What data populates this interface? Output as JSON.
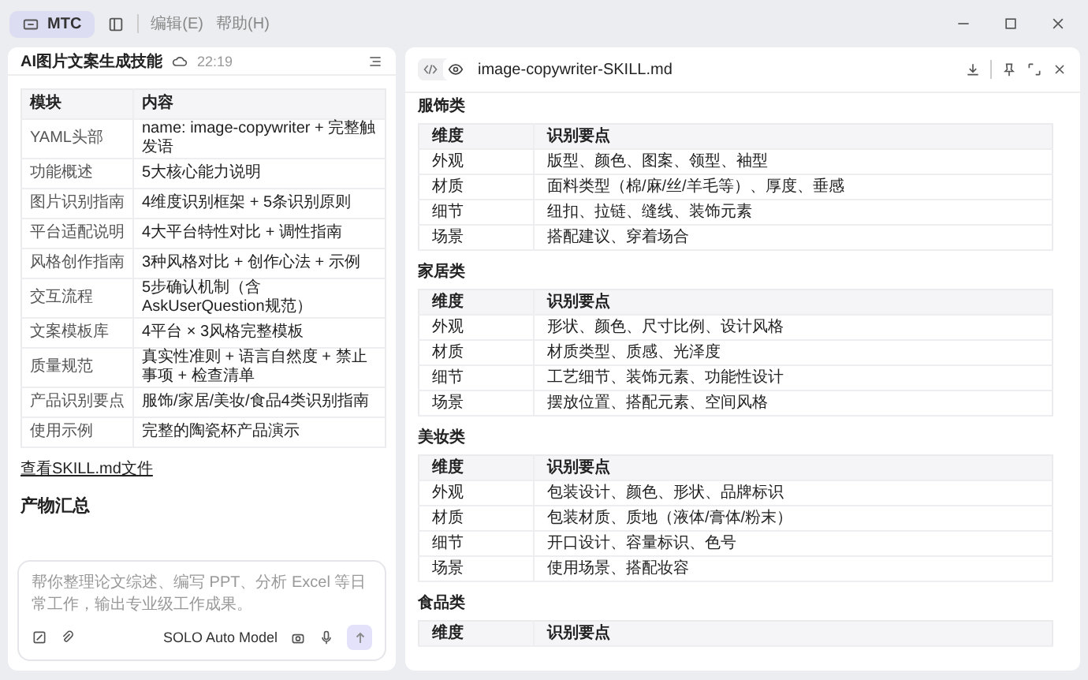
{
  "titlebar": {
    "tabs": [
      {
        "label": "MTC",
        "selected": true
      }
    ],
    "menus": [
      "编辑(E)",
      "帮助(H)"
    ]
  },
  "chat": {
    "title": "AI图片文案生成技能",
    "time": "22:19",
    "table": {
      "columns": [
        "模块",
        "内容"
      ],
      "rows": [
        [
          "YAML头部",
          "name: image-copywriter + 完整触发语"
        ],
        [
          "功能概述",
          "5大核心能力说明"
        ],
        [
          "图片识别指南",
          "4维度识别框架 + 5条识别原则"
        ],
        [
          "平台适配说明",
          "4大平台特性对比 + 调性指南"
        ],
        [
          "风格创作指南",
          "3种风格对比 + 创作心法 + 示例"
        ],
        [
          "交互流程",
          "5步确认机制（含AskUserQuestion规范）"
        ],
        [
          "文案模板库",
          "4平台 × 3风格完整模板"
        ],
        [
          "质量规范",
          "真实性准则 + 语言自然度 + 禁止事项 + 检查清单"
        ],
        [
          "产品识别要点",
          "服饰/家居/美妆/食品4类识别指南"
        ],
        [
          "使用示例",
          "完整的陶瓷杯产品演示"
        ]
      ]
    },
    "link": "查看SKILL.md文件",
    "heading": "产物汇总",
    "input": {
      "placeholder": "帮你整理论文综述、编写 PPT、分析 Excel 等日常工作，输出专业级工作成果。",
      "model": "SOLO Auto Model"
    }
  },
  "preview": {
    "filename": "image-copywriter-SKILL.md",
    "view_modes": [
      {
        "kind": "code",
        "selected": false
      },
      {
        "kind": "preview",
        "selected": true
      }
    ],
    "sections": [
      {
        "title": "服饰类",
        "columns": [
          "维度",
          "识别要点"
        ],
        "rows": [
          [
            "外观",
            "版型、颜色、图案、领型、袖型"
          ],
          [
            "材质",
            "面料类型（棉/麻/丝/羊毛等）、厚度、垂感"
          ],
          [
            "细节",
            "纽扣、拉链、缝线、装饰元素"
          ],
          [
            "场景",
            "搭配建议、穿着场合"
          ]
        ]
      },
      {
        "title": "家居类",
        "columns": [
          "维度",
          "识别要点"
        ],
        "rows": [
          [
            "外观",
            "形状、颜色、尺寸比例、设计风格"
          ],
          [
            "材质",
            "材质类型、质感、光泽度"
          ],
          [
            "细节",
            "工艺细节、装饰元素、功能性设计"
          ],
          [
            "场景",
            "摆放位置、搭配元素、空间风格"
          ]
        ]
      },
      {
        "title": "美妆类",
        "columns": [
          "维度",
          "识别要点"
        ],
        "rows": [
          [
            "外观",
            "包装设计、颜色、形状、品牌标识"
          ],
          [
            "材质",
            "包装材质、质地（液体/膏体/粉末）"
          ],
          [
            "细节",
            "开口设计、容量标识、色号"
          ],
          [
            "场景",
            "使用场景、搭配妆容"
          ]
        ]
      },
      {
        "title": "食品类",
        "columns": [
          "维度",
          "识别要点"
        ]
      }
    ]
  }
}
